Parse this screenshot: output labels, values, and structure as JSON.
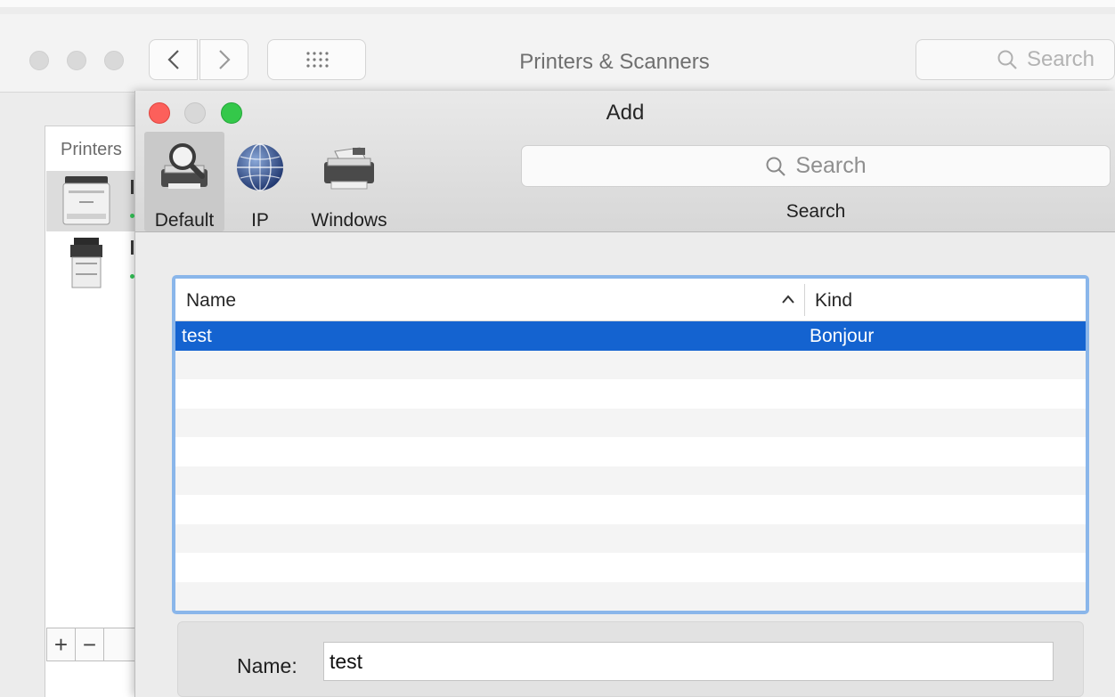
{
  "background_window": {
    "title": "Printers & Scanners",
    "search_placeholder": "Search",
    "sidebar_label": "Printers",
    "add_button": "+",
    "remove_button": "−",
    "printers": [
      {
        "icon": "laser-printer-icon",
        "status_color": "#34c759"
      },
      {
        "icon": "multifunction-printer-icon",
        "status_color": "#34c759"
      }
    ]
  },
  "add_dialog": {
    "title": "Add",
    "toolbar": {
      "items": [
        {
          "label": "Default",
          "icon": "magnifier-printer-icon",
          "selected": true
        },
        {
          "label": "IP",
          "icon": "globe-icon",
          "selected": false
        },
        {
          "label": "Windows",
          "icon": "printer-icon",
          "selected": false
        }
      ],
      "search_placeholder": "Search",
      "search_label": "Search"
    },
    "table": {
      "columns": [
        "Name",
        "Kind"
      ],
      "sort_column": "Name",
      "sort_direction": "ascending",
      "rows": [
        {
          "name": "test",
          "kind": "Bonjour",
          "selected": true
        }
      ],
      "selection_color": "#1463d0"
    },
    "form": {
      "name_label": "Name:",
      "name_value": "test"
    }
  },
  "colors": {
    "close": "#fc605b",
    "minimize_inactive": "#d8d8d8",
    "zoom": "#34c84a",
    "focus_ring": "#8ab6ea"
  }
}
